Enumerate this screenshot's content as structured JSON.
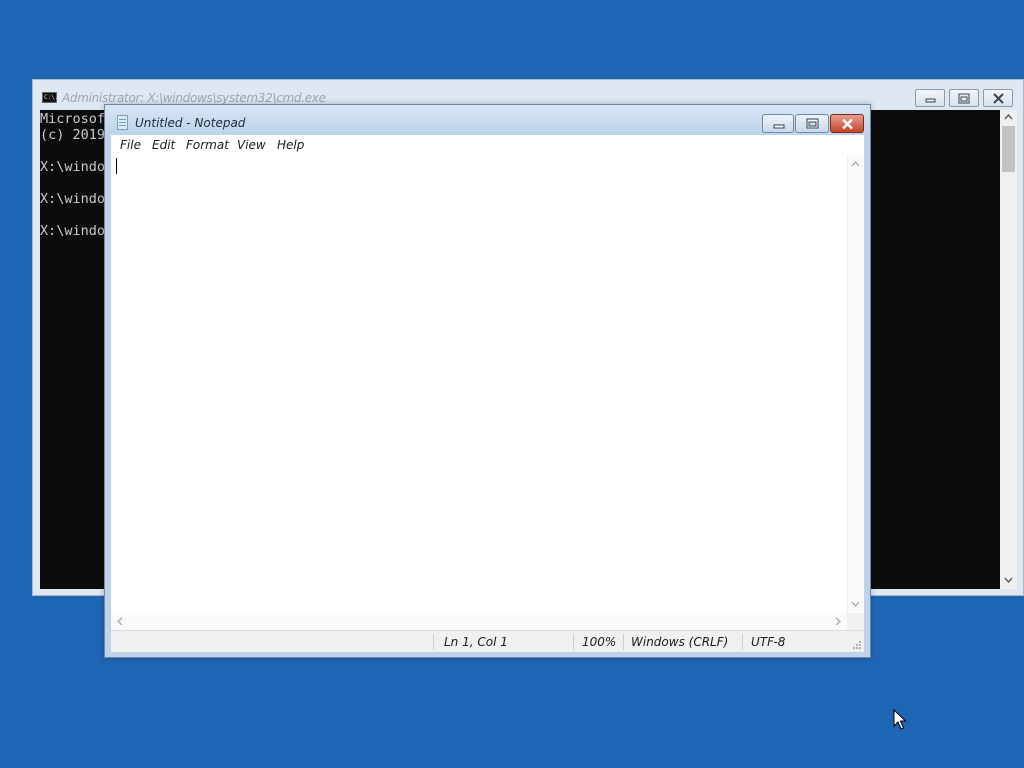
{
  "desktop": {
    "background": "#1e66b4"
  },
  "cmd": {
    "title": "Administrator: X:\\windows\\system32\\cmd.exe",
    "icon": "console-icon",
    "icon_text": "C:\\.",
    "lines": [
      "Microsof",
      "(c) 2019",
      "",
      "X:\\windo",
      "",
      "X:\\windo",
      "",
      "X:\\windo"
    ]
  },
  "notepad": {
    "title": "Untitled - Notepad",
    "icon": "notepad-icon",
    "menu": {
      "file": "File",
      "edit": "Edit",
      "format": "Format",
      "view": "View",
      "help": "Help"
    },
    "content": "",
    "status": {
      "position": "Ln 1, Col 1",
      "zoom": "100%",
      "line_ending": "Windows (CRLF)",
      "encoding": "UTF-8"
    }
  },
  "colors": {
    "close_button": "#c7442c",
    "console_bg": "#0c0c0c",
    "console_text": "#cccccc"
  }
}
